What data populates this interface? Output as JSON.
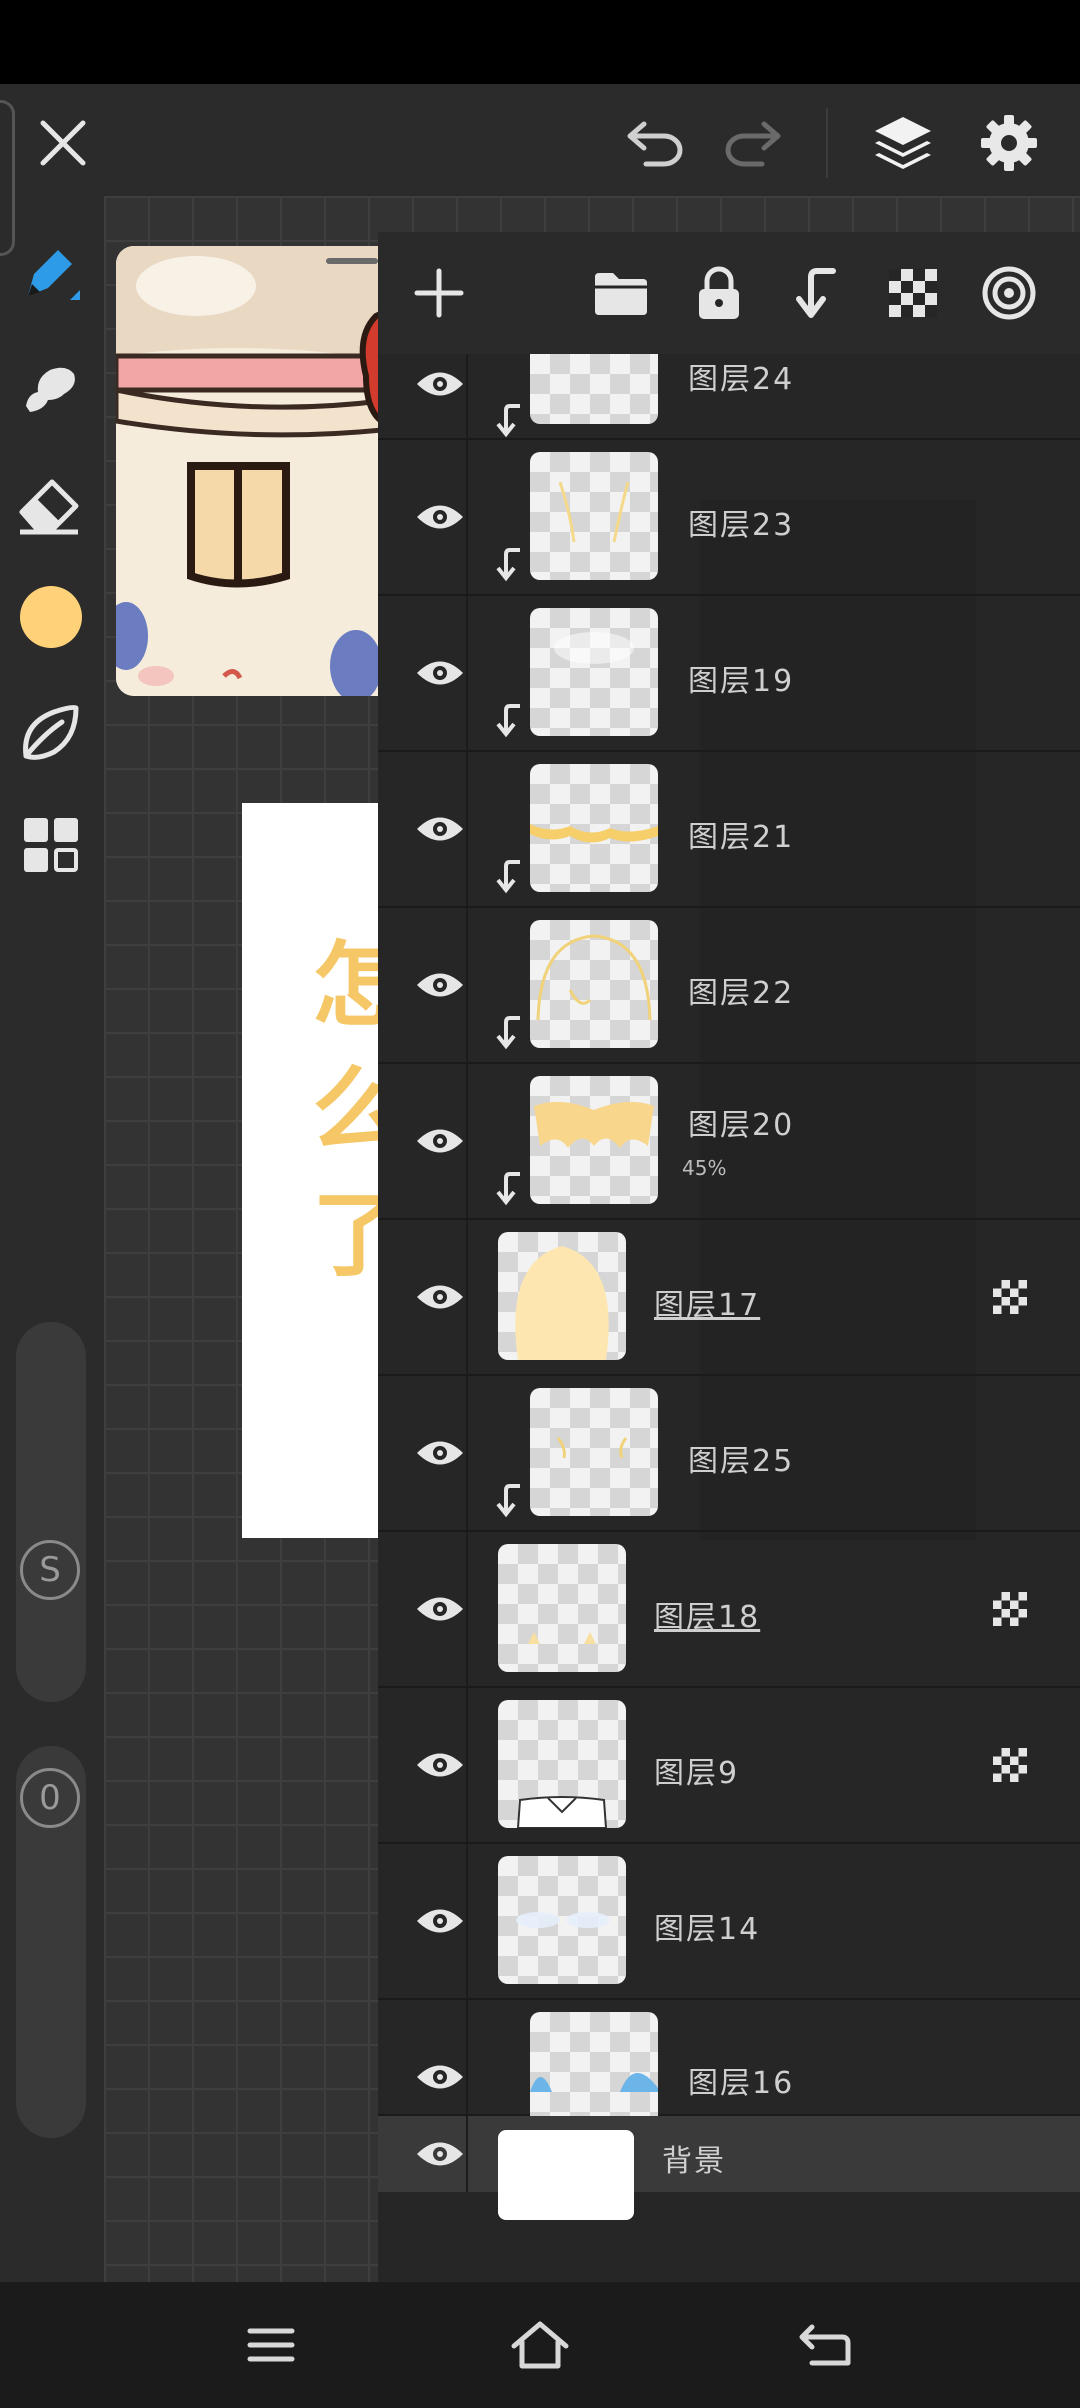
{
  "panel": {
    "layers": [
      {
        "name": "图层24",
        "clipped": true,
        "alpha_lock": false
      },
      {
        "name": "图层23",
        "clipped": true,
        "alpha_lock": false
      },
      {
        "name": "图层19",
        "clipped": true,
        "alpha_lock": false
      },
      {
        "name": "图层21",
        "clipped": true,
        "alpha_lock": false
      },
      {
        "name": "图层22",
        "clipped": true,
        "alpha_lock": false
      },
      {
        "name": "图层20",
        "clipped": true,
        "alpha_lock": false,
        "opacity": "45%"
      },
      {
        "name": "图层17",
        "clipped": false,
        "alpha_lock": true
      },
      {
        "name": "图层25",
        "clipped": true,
        "alpha_lock": false
      },
      {
        "name": "图层18",
        "clipped": false,
        "alpha_lock": true
      },
      {
        "name": "图层9",
        "clipped": false,
        "alpha_lock": true
      },
      {
        "name": "图层14",
        "clipped": false,
        "alpha_lock": false
      },
      {
        "name": "图层16",
        "clipped": true,
        "alpha_lock": false
      },
      {
        "name": "背景",
        "clipped": false,
        "alpha_lock": false,
        "selected": true
      }
    ]
  },
  "leftbar": {
    "current_color": "#FFD27A",
    "size_badge": "S",
    "opacity_badge": "0"
  },
  "canvas": {
    "artwork_text": "怎么了"
  },
  "colors": {
    "accent": "#2E9BE8",
    "panel_bg": "#262626",
    "selected_row": "#3a3a3a"
  }
}
